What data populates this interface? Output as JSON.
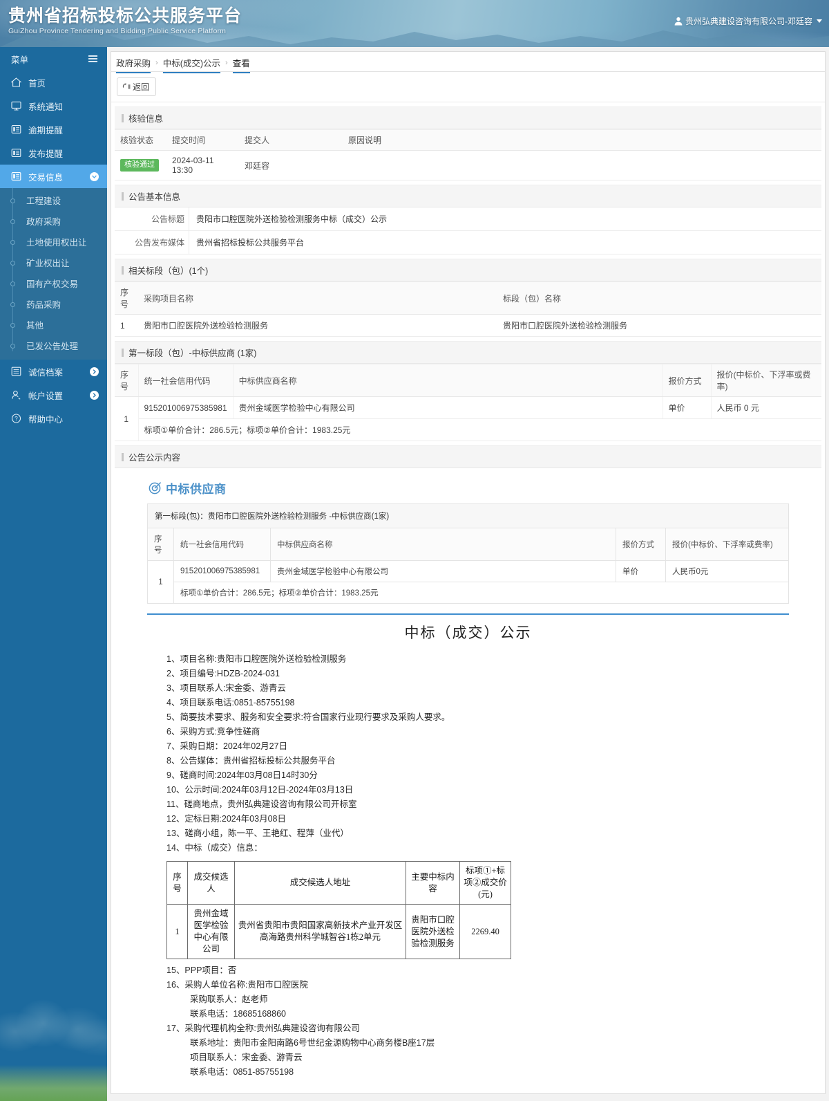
{
  "banner": {
    "title": "贵州省招标投标公共服务平台",
    "subtitle": "GuiZhou Province Tendering and Bidding Public Service Platform",
    "user": "贵州弘典建设咨询有限公司-邓廷容"
  },
  "sidebar": {
    "menu_label": "菜单",
    "items": [
      {
        "label": "首页",
        "icon": "home-icon"
      },
      {
        "label": "系统通知",
        "icon": "monitor-icon"
      },
      {
        "label": "逾期提醒",
        "icon": "document-icon"
      },
      {
        "label": "发布提醒",
        "icon": "document-icon"
      },
      {
        "label": "交易信息",
        "icon": "document-icon",
        "active": true,
        "expanded": true
      }
    ],
    "sub_items": [
      {
        "label": "工程建设"
      },
      {
        "label": "政府采购"
      },
      {
        "label": "土地使用权出让"
      },
      {
        "label": "矿业权出让"
      },
      {
        "label": "国有产权交易"
      },
      {
        "label": "药品采购"
      },
      {
        "label": "其他"
      },
      {
        "label": "已发公告处理"
      }
    ],
    "bottom_items": [
      {
        "label": "诚信档案",
        "icon": "list-icon",
        "has_arrow": true
      },
      {
        "label": "帐户设置",
        "icon": "user-icon",
        "has_arrow": true
      },
      {
        "label": "帮助中心",
        "icon": "question-icon",
        "has_arrow": false
      }
    ]
  },
  "breadcrumb": {
    "items": [
      "政府采购",
      "中标(成交)公示",
      "查看"
    ],
    "separator": "›"
  },
  "toolbar": {
    "back_label": "返回"
  },
  "sections": {
    "verify": {
      "title": "核验信息",
      "headers": [
        "核验状态",
        "提交时间",
        "提交人",
        "原因说明"
      ],
      "row": {
        "status": "核验通过",
        "submit_time": "2024-03-11 13:30",
        "submitter": "邓廷容",
        "reason": ""
      }
    },
    "basic": {
      "title": "公告基本信息",
      "fields": [
        {
          "label": "公告标题",
          "value": "贵阳市口腔医院外送检验检测服务中标（成交）公示"
        },
        {
          "label": "公告发布媒体",
          "value": "贵州省招标投标公共服务平台"
        }
      ]
    },
    "lots": {
      "title": "相关标段（包）(1个)",
      "headers": [
        "序号",
        "采购项目名称",
        "标段（包）名称"
      ],
      "rows": [
        {
          "no": "1",
          "project": "贵阳市口腔医院外送检验检测服务",
          "lot": "贵阳市口腔医院外送检验检测服务"
        }
      ]
    },
    "winner": {
      "title": "第一标段（包）-中标供应商 (1家)",
      "headers": [
        "序号",
        "统一社会信用代码",
        "中标供应商名称",
        "报价方式",
        "报价(中标价、下浮率或费率)"
      ],
      "rows": [
        {
          "no": "1",
          "code": "915201006975385981",
          "name": "贵州金域医学检验中心有限公司",
          "mode": "单价",
          "price": "人民币 0 元",
          "note": "标项①单价合计：286.5元；标项②单价合计：1983.25元"
        }
      ]
    },
    "announcement": {
      "title": "公告公示内容"
    }
  },
  "announcement": {
    "logo_text": "中标供应商",
    "logo_icon": "target-icon",
    "lot_header": "第一标段(包)：贵阳市口腔医院外送检验检测服务 -中标供应商(1家)",
    "table_headers": [
      "序号",
      "统一社会信用代码",
      "中标供应商名称",
      "报价方式",
      "报价(中标价、下浮率或费率)"
    ],
    "table_rows": [
      {
        "no": "1",
        "code": "915201006975385981",
        "name": "贵州金域医学检验中心有限公司",
        "mode": "单价",
        "price": "人民币0元",
        "note": "标项①单价合计：286.5元；标项②单价合计：1983.25元"
      }
    ],
    "doc_title": "中标（成交）公示",
    "lines": [
      "1、项目名称:贵阳市口腔医院外送检验检测服务",
      "2、项目编号:HDZB-2024-031",
      "3、项目联系人:宋金委、游青云",
      "4、项目联系电话:0851-85755198",
      "5、简要技术要求、服务和安全要求:符合国家行业现行要求及采购人要求。",
      "6、采购方式:竞争性磋商",
      "7、采购日期：2024年02月27日",
      "8、公告媒体：贵州省招标投标公共服务平台",
      "9、磋商时间:2024年03月08日14时30分",
      "10、公示时间:2024年03月12日-2024年03月13日",
      "11、磋商地点，贵州弘典建设咨询有限公司开标室",
      "12、定标日期:2024年03月08日",
      "13、磋商小组，陈一平、王艳红、程萍（业代）",
      "14、中标（成交）信息："
    ],
    "bid_table": {
      "headers": [
        "序号",
        "成交候选人",
        "成交候选人地址",
        "主要中标内容",
        "标项①+标项②成交价(元)"
      ],
      "rows": [
        {
          "no": "1",
          "candidate": "贵州金域医学检验中心有限公司",
          "address": "贵州省贵阳市贵阳国家高新技术产业开发区高海路贵州科学城智谷1栋2单元",
          "content": "贵阳市口腔医院外送检验检测服务",
          "price": "2269.40"
        }
      ]
    },
    "tail_lines": [
      {
        "text": "15、PPP项目：否",
        "indent": false
      },
      {
        "text": "16、采购人单位名称:贵阳市口腔医院",
        "indent": false
      },
      {
        "text": "采购联系人：赵老师",
        "indent": true
      },
      {
        "text": "联系电话：18685168860",
        "indent": true
      },
      {
        "text": "17、采购代理机构全称:贵州弘典建设咨询有限公司",
        "indent": false
      },
      {
        "text": "联系地址：贵阳市金阳南路6号世纪金源购物中心商务楼B座17层",
        "indent": true
      },
      {
        "text": "项目联系人：宋金委、游青云",
        "indent": true
      },
      {
        "text": "联系电话：0851-85755198",
        "indent": true
      }
    ]
  },
  "colors": {
    "sidebar": "#1c6a9e",
    "sidebar_active": "#52a8e8",
    "accent": "#3f8dcf",
    "success": "#5cb85c",
    "logo_blue": "#4a90c8"
  }
}
